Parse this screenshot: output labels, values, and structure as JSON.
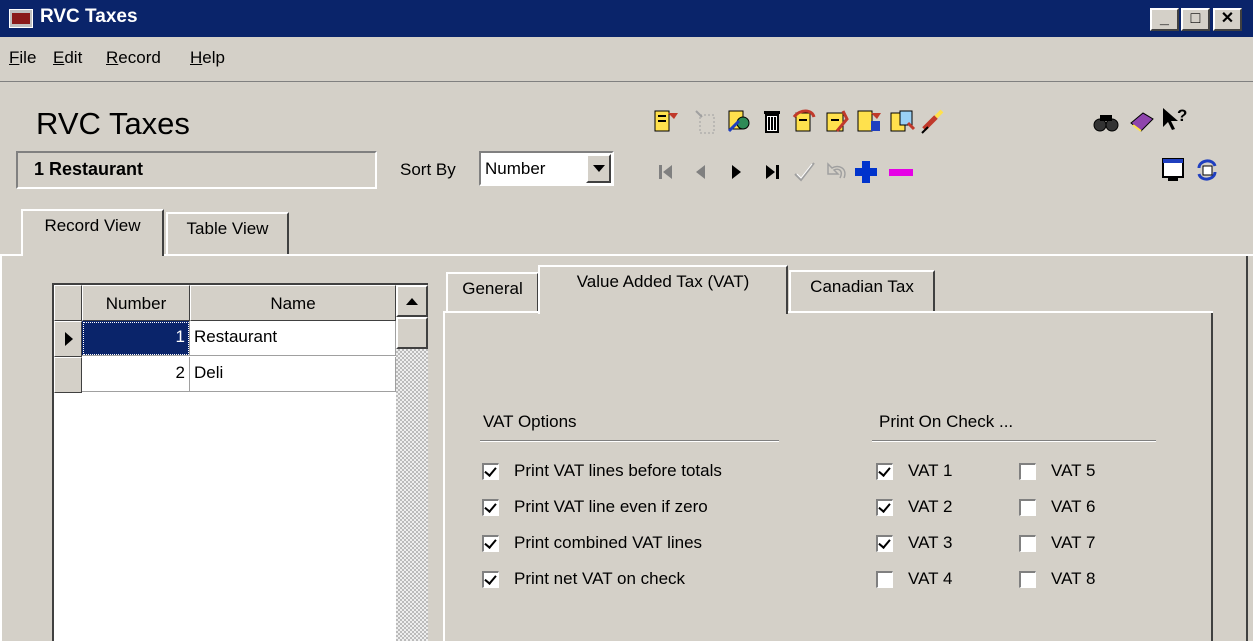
{
  "window": {
    "title": "RVC Taxes",
    "controls": {
      "minimize": "_",
      "maximize": "□",
      "close": "✕"
    }
  },
  "menu": [
    {
      "label": "File",
      "hotkey": "F",
      "rest": "ile"
    },
    {
      "label": "Edit",
      "hotkey": "E",
      "rest": "dit"
    },
    {
      "label": "Record",
      "hotkey": "R",
      "rest": "ecord"
    },
    {
      "label": "Help",
      "hotkey": "H",
      "rest": "elp"
    }
  ],
  "header": {
    "title": "RVC Taxes",
    "current_record": "1 Restaurant",
    "sort_label": "Sort By",
    "sort_value": "Number"
  },
  "toolbar": {
    "icons": [
      "new-record-icon",
      "new-record-disabled-icon",
      "edit-record-icon",
      "delete-icon",
      "copy-icon",
      "paste-icon",
      "save-icon",
      "export-icon",
      "clear-icon"
    ],
    "nav_icons": [
      "first-record-icon",
      "previous-record-icon",
      "next-record-icon",
      "last-record-icon",
      "confirm-icon",
      "undo-icon",
      "add-icon",
      "remove-icon"
    ],
    "right_icons": [
      "find-icon",
      "book-icon",
      "help-pointer-icon",
      "window-icon",
      "refresh-icon"
    ]
  },
  "view_tabs": [
    "Record View",
    "Table View"
  ],
  "grid": {
    "columns": [
      "Number",
      "Name"
    ],
    "rows": [
      {
        "number": "1",
        "name": "Restaurant",
        "selected": true
      },
      {
        "number": "2",
        "name": "Deli",
        "selected": false
      }
    ]
  },
  "detail_tabs": [
    "General",
    "Value Added Tax (VAT)",
    "Canadian Tax"
  ],
  "vat_options": {
    "title": "VAT Options",
    "items": [
      {
        "label": "Print VAT lines before totals",
        "checked": true
      },
      {
        "label": "Print VAT line even if zero",
        "checked": true
      },
      {
        "label": "Print combined VAT lines",
        "checked": true
      },
      {
        "label": "Print net VAT on check",
        "checked": true
      }
    ]
  },
  "print_on_check": {
    "title": "Print On Check ...",
    "items": [
      {
        "label": "VAT 1",
        "checked": true
      },
      {
        "label": "VAT 2",
        "checked": true
      },
      {
        "label": "VAT 3",
        "checked": true
      },
      {
        "label": "VAT 4",
        "checked": false
      },
      {
        "label": "VAT 5",
        "checked": false
      },
      {
        "label": "VAT 6",
        "checked": false
      },
      {
        "label": "VAT 7",
        "checked": false
      },
      {
        "label": "VAT 8",
        "checked": false
      }
    ]
  }
}
